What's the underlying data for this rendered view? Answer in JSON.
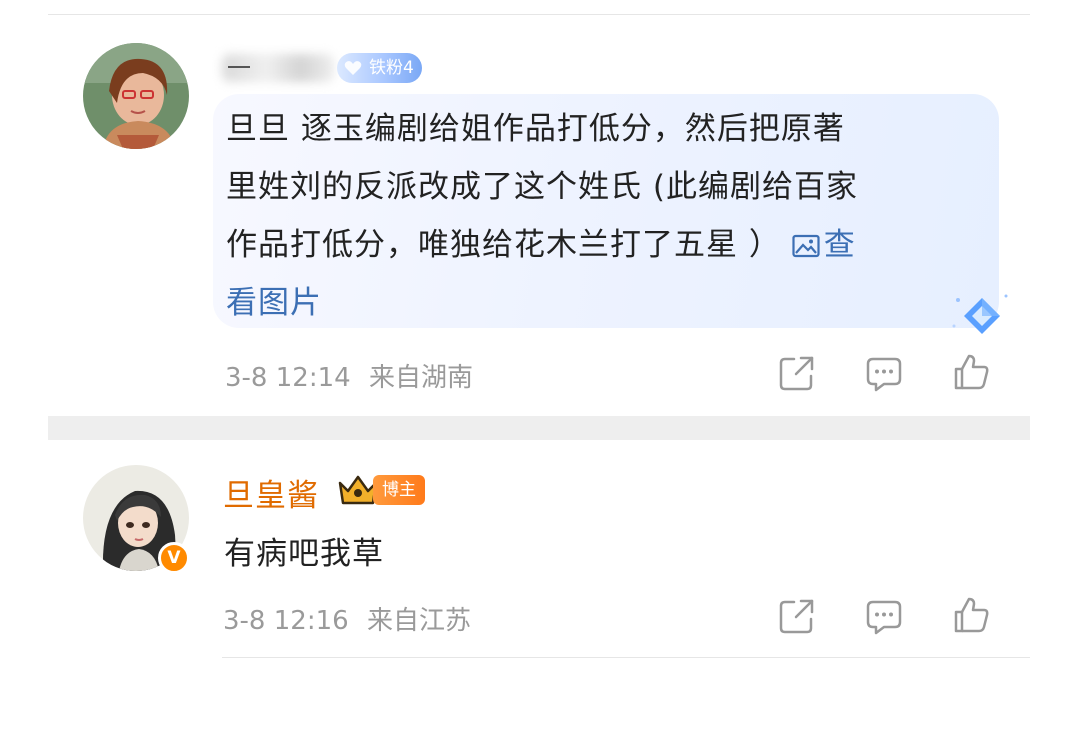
{
  "comments": [
    {
      "fan_badge": "铁粉4",
      "text_lines": [
        "旦旦 逐玉编剧给姐作品打低分，然后把原著",
        "里姓刘的反派改成了这个姓氏 (此编剧给百家",
        "作品打低分，唯独给花木兰打了五星 ）"
      ],
      "view_image_part1": "查",
      "view_image_part2": "看图片",
      "time": "3-8 12:14",
      "location": "来自湖南",
      "actions": [
        "share-icon",
        "comment-icon",
        "like-icon"
      ]
    },
    {
      "username": "旦皇酱",
      "badge": "博主",
      "verified_mark": "V",
      "text": "有病吧我草",
      "time": "3-8 12:16",
      "location": "来自江苏",
      "actions": [
        "share-icon",
        "comment-icon",
        "like-icon"
      ]
    }
  ],
  "colors": {
    "username_orange": "#e06b00",
    "link_blue": "#3c6fb4",
    "meta_gray": "#9a9a9a",
    "fan_badge_blue": "#7aa8f5",
    "blogger_badge_orange": "#ff7a1a"
  }
}
